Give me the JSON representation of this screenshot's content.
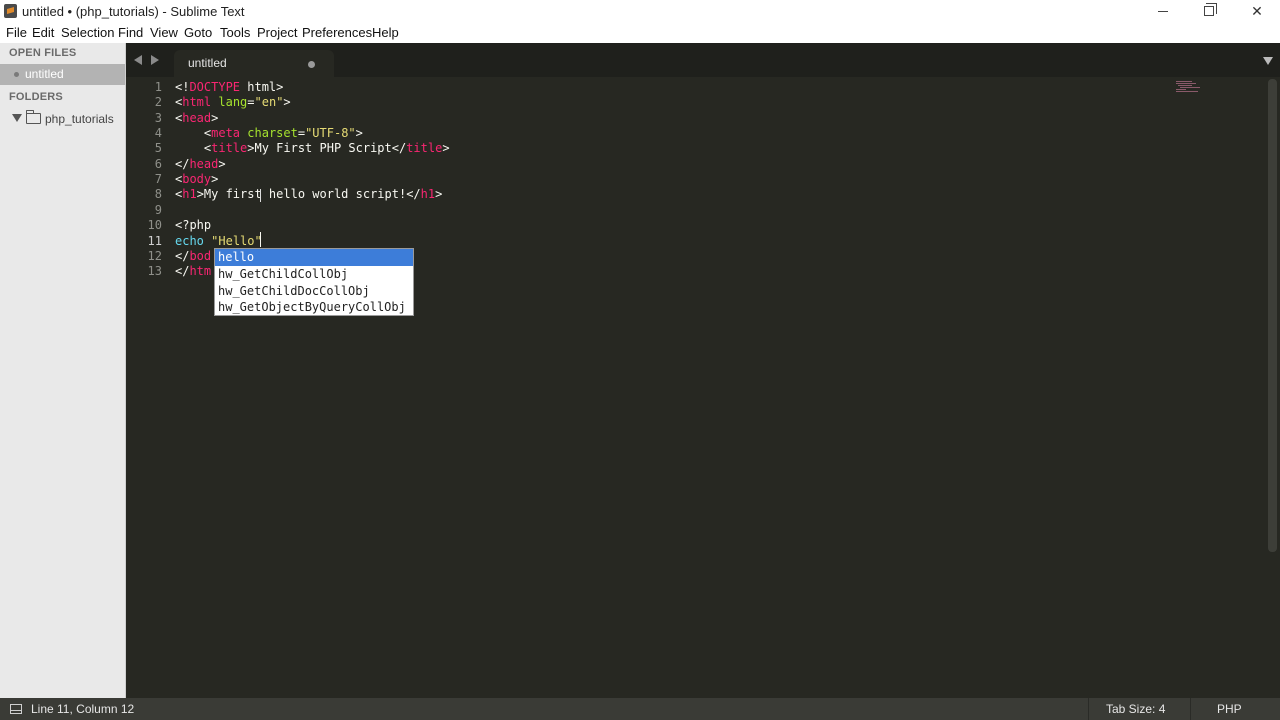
{
  "window": {
    "title": "untitled • (php_tutorials) - Sublime Text",
    "controls": {
      "minimize": "minimize-icon",
      "maximize": "restore-icon",
      "close": "close-icon"
    }
  },
  "menu": [
    "File",
    "Edit",
    "Selection",
    "Find",
    "View",
    "Goto",
    "Tools",
    "Project",
    "Preferences",
    "Help"
  ],
  "sidebar": {
    "open_files_header": "OPEN FILES",
    "open_files": [
      {
        "label": "untitled"
      }
    ],
    "folders_header": "FOLDERS",
    "folders": [
      {
        "label": "php_tutorials"
      }
    ]
  },
  "tabs": [
    {
      "label": "untitled",
      "dirty": true
    }
  ],
  "editor": {
    "line_numbers": [
      "1",
      "2",
      "3",
      "4",
      "5",
      "6",
      "7",
      "8",
      "9",
      "10",
      "11",
      "12",
      "13"
    ],
    "active_line": 11,
    "lines": [
      [
        [
          "<!",
          "t-txt"
        ],
        [
          "DOCTYPE",
          "t-tag"
        ],
        [
          " html>",
          "t-txt"
        ]
      ],
      [
        [
          "<",
          "t-txt"
        ],
        [
          "html",
          "t-tag"
        ],
        [
          " ",
          "t-txt"
        ],
        [
          "lang",
          "t-attr"
        ],
        [
          "=",
          "t-txt"
        ],
        [
          "\"en\"",
          "t-str"
        ],
        [
          ">",
          "t-txt"
        ]
      ],
      [
        [
          "<",
          "t-txt"
        ],
        [
          "head",
          "t-tag"
        ],
        [
          ">",
          "t-txt"
        ]
      ],
      [
        [
          "    <",
          "t-txt"
        ],
        [
          "meta",
          "t-tag"
        ],
        [
          " ",
          "t-txt"
        ],
        [
          "charset",
          "t-attr"
        ],
        [
          "=",
          "t-txt"
        ],
        [
          "\"UTF-8\"",
          "t-str"
        ],
        [
          ">",
          "t-txt"
        ]
      ],
      [
        [
          "    <",
          "t-txt"
        ],
        [
          "title",
          "t-tag"
        ],
        [
          ">My First PHP Script</",
          "t-txt"
        ],
        [
          "title",
          "t-tag"
        ],
        [
          ">",
          "t-txt"
        ]
      ],
      [
        [
          "</",
          "t-txt"
        ],
        [
          "head",
          "t-tag"
        ],
        [
          ">",
          "t-txt"
        ]
      ],
      [
        [
          "<",
          "t-txt"
        ],
        [
          "body",
          "t-tag"
        ],
        [
          ">",
          "t-txt"
        ]
      ],
      [
        [
          "<",
          "t-txt"
        ],
        [
          "h1",
          "t-tag"
        ],
        [
          ">My first hello world script!</",
          "t-txt"
        ],
        [
          "h1",
          "t-tag"
        ],
        [
          ">",
          "t-txt"
        ]
      ],
      [],
      [
        [
          "<?php",
          "t-txt"
        ]
      ],
      [
        [
          "echo",
          "t-kw"
        ],
        [
          " ",
          "t-txt"
        ],
        [
          "\"Hello\"",
          "t-str"
        ]
      ],
      [
        [
          "</",
          "t-txt"
        ],
        [
          "bod",
          "t-tag"
        ]
      ],
      [
        [
          "</",
          "t-txt"
        ],
        [
          "htm",
          "t-tag"
        ]
      ]
    ]
  },
  "autocomplete": {
    "items": [
      "hello",
      "hw_GetChildCollObj",
      "hw_GetChildDocCollObj",
      "hw_GetObjectByQueryCollObj"
    ],
    "selected_index": 0
  },
  "status": {
    "position": "Line 11, Column 12",
    "tab_size": "Tab Size: 4",
    "syntax": "PHP"
  }
}
